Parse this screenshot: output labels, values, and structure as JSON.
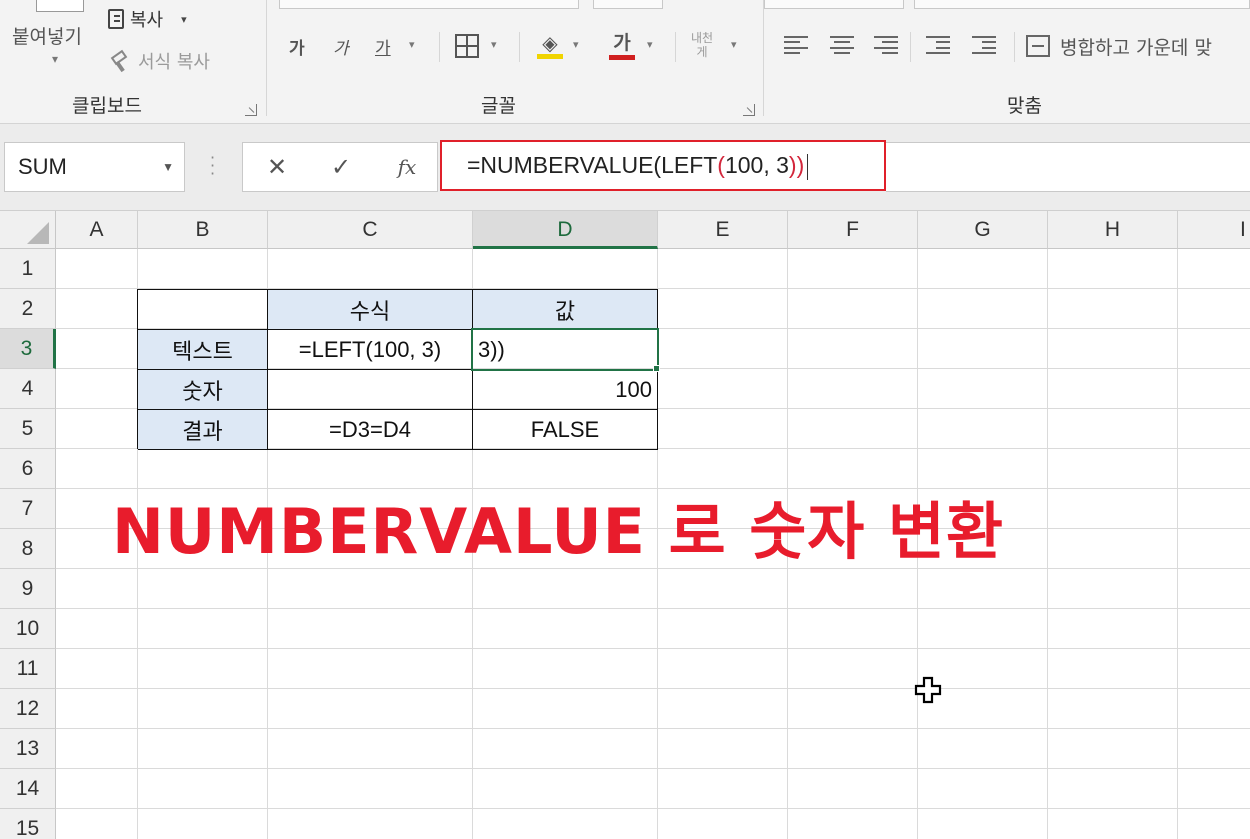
{
  "ribbon": {
    "clipboard": {
      "paste_label": "붙여넣기",
      "copy_label": "복사",
      "format_painter_label": "서식 복사",
      "group_label": "클립보드"
    },
    "font": {
      "bold_label": "가",
      "italic_label": "가",
      "underline_label": "가",
      "font_color_label": "가",
      "special_label_top": "내천",
      "special_label_bottom": "게",
      "group_label": "글꼴"
    },
    "alignment": {
      "merge_label": "병합하고 가운데 맞",
      "group_label": "맞춤"
    }
  },
  "formula_bar": {
    "name_box": "SUM",
    "formula_parts": [
      "=NUMBERVALUE(LEFT",
      "(",
      "100, 3",
      "))"
    ],
    "cancel_symbol": "✕",
    "enter_symbol": "✓",
    "fx_symbol": "fx"
  },
  "columns": [
    "A",
    "B",
    "C",
    "D",
    "E",
    "F",
    "G",
    "H",
    "I"
  ],
  "rows": [
    "1",
    "2",
    "3",
    "4",
    "5",
    "6",
    "7",
    "8",
    "9",
    "10",
    "11",
    "12",
    "13",
    "14",
    "15"
  ],
  "table": {
    "header_formula": "수식",
    "header_value": "값",
    "row_text_label": "텍스트",
    "row_text_formula": "=LEFT(100, 3)",
    "row_text_value": "3))",
    "row_number_label": "숫자",
    "row_number_formula": "",
    "row_number_value": "100",
    "row_result_label": "결과",
    "row_result_formula": "=D3=D4",
    "row_result_value": "FALSE"
  },
  "caption": "NUMBERVALUE 로 숫자 변환",
  "colors": {
    "accent_green": "#217346",
    "highlight_red": "#e81c2c",
    "header_fill": "#dde8f5"
  }
}
